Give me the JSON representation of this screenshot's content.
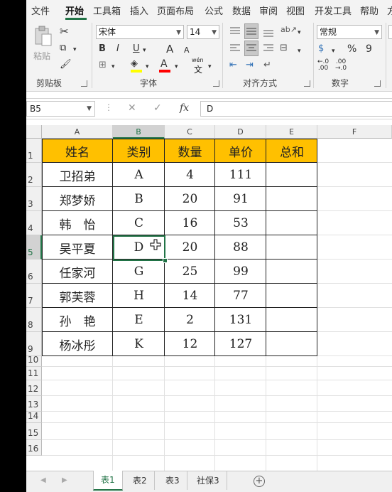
{
  "ribbon_tabs": [
    "文件",
    "开始",
    "工具箱",
    "插入",
    "页面布局",
    "公式",
    "数据",
    "审阅",
    "视图",
    "开发工具",
    "帮助",
    "方"
  ],
  "active_tab": "开始",
  "clipboard": {
    "paste_label": "粘贴",
    "group_label": "剪贴板"
  },
  "font": {
    "name": "宋体",
    "size": "14",
    "group_label": "字体",
    "bold": "B",
    "italic": "I",
    "underline": "U",
    "grow": "A",
    "shrink": "A",
    "wen": "wén",
    "wen_char": "文",
    "font_color_letter": "A"
  },
  "alignment": {
    "group_label": "对齐方式"
  },
  "number": {
    "format": "常规",
    "group_label": "数字",
    "percent": "%",
    "comma": "9",
    "inc_decimal": "←.0\n.00",
    "dec_decimal": ".00\n→.0"
  },
  "formula_bar": {
    "name_box": "B5",
    "fx": "fx",
    "value": "D"
  },
  "columns": [
    "A",
    "B",
    "C",
    "D",
    "E",
    "F"
  ],
  "active_column": "B",
  "rows": [
    "1",
    "2",
    "3",
    "4",
    "5",
    "6",
    "7",
    "8",
    "9",
    "10",
    "11",
    "12",
    "13",
    "14",
    "15",
    "16"
  ],
  "active_row": "5",
  "table": {
    "headers": [
      "姓名",
      "类别",
      "数量",
      "单价",
      "总和"
    ],
    "rows": [
      [
        "卫招弟",
        "A",
        "4",
        "111",
        ""
      ],
      [
        "郑梦娇",
        "B",
        "20",
        "91",
        ""
      ],
      [
        "韩　怡",
        "C",
        "16",
        "53",
        ""
      ],
      [
        "吴平夏",
        "D",
        "20",
        "88",
        ""
      ],
      [
        "任家河",
        "G",
        "25",
        "99",
        ""
      ],
      [
        "郭芙蓉",
        "H",
        "14",
        "77",
        ""
      ],
      [
        "孙　艳",
        "E",
        "2",
        "131",
        ""
      ],
      [
        "杨冰彤",
        "K",
        "12",
        "127",
        ""
      ]
    ],
    "header_color": "#ffc000"
  },
  "sheets": [
    "表1",
    "表2",
    "表3",
    "社保3"
  ],
  "active_sheet": "表1",
  "accent": "#217346"
}
